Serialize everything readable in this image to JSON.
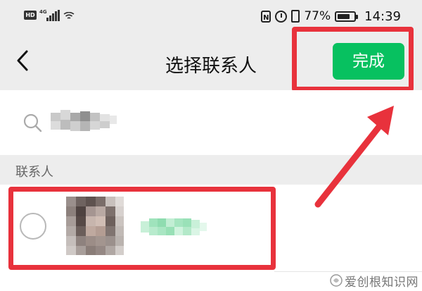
{
  "status_bar": {
    "hd": "HD",
    "network": "4G",
    "battery_percent": "77%",
    "battery_level": 0.77,
    "time": "14:39",
    "icons": [
      "hd-icon",
      "signal-icon",
      "wifi-icon",
      "nfc-icon",
      "alarm-icon",
      "vibrate-icon",
      "battery-icon"
    ]
  },
  "nav": {
    "back_icon": "chevron-left-icon",
    "title": "选择联系人",
    "done_label": "完成"
  },
  "search": {
    "icon": "search-icon",
    "value_redacted": true
  },
  "contacts": {
    "section_label": "联系人",
    "items": [
      {
        "name_redacted": true,
        "selected": false
      }
    ]
  },
  "annotations": {
    "highlight_color": "#e8323c"
  },
  "watermark": {
    "text": "爱创根知识网"
  },
  "colors": {
    "accent": "#07c160",
    "header_bg": "#ededed",
    "annotation": "#e8323c"
  }
}
